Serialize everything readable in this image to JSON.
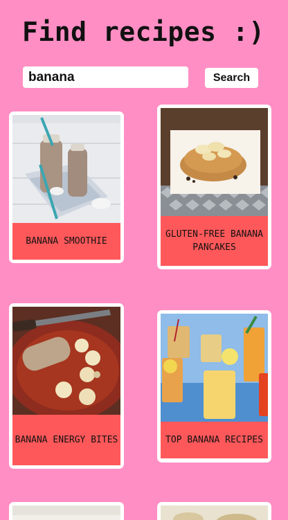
{
  "header": {
    "title": "Find recipes :)"
  },
  "search": {
    "value": "banana",
    "placeholder": "",
    "button_label": "Search"
  },
  "recipes": [
    {
      "label": "BANANA SMOOTHIE"
    },
    {
      "label": "GLUTEN-FREE BANANA PANCAKES"
    },
    {
      "label": "BANANA ENERGY BITES"
    },
    {
      "label": "TOP BANANA RECIPES"
    }
  ],
  "colors": {
    "background": "#ff8ec4",
    "card_label": "#ff585a",
    "card": "#ffffff"
  }
}
